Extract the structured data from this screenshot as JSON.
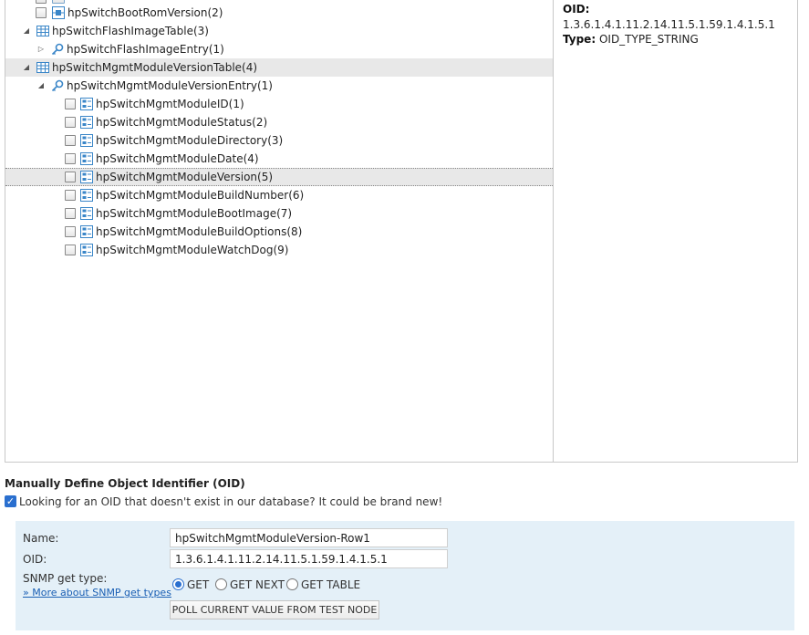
{
  "tree": {
    "nodes": [
      {
        "label": "hpSwitchBootRomVersion(2)",
        "type": "scalar",
        "checkbox": true,
        "expander": ""
      },
      {
        "label": "hpSwitchFlashImageTable(3)",
        "type": "table",
        "checkbox": false,
        "expander": "◢"
      },
      {
        "label": "hpSwitchFlashImageEntry(1)",
        "type": "entry",
        "checkbox": false,
        "expander": "▷"
      },
      {
        "label": "hpSwitchMgmtModuleVersionTable(4)",
        "type": "table",
        "checkbox": false,
        "expander": "◢",
        "highlighted": true
      },
      {
        "label": "hpSwitchMgmtModuleVersionEntry(1)",
        "type": "entry",
        "checkbox": false,
        "expander": "◢"
      },
      {
        "label": "hpSwitchMgmtModuleID(1)",
        "type": "column",
        "checkbox": true,
        "expander": ""
      },
      {
        "label": "hpSwitchMgmtModuleStatus(2)",
        "type": "column",
        "checkbox": true,
        "expander": ""
      },
      {
        "label": "hpSwitchMgmtModuleDirectory(3)",
        "type": "column",
        "checkbox": true,
        "expander": ""
      },
      {
        "label": "hpSwitchMgmtModuleDate(4)",
        "type": "column",
        "checkbox": true,
        "expander": ""
      },
      {
        "label": "hpSwitchMgmtModuleVersion(5)",
        "type": "column",
        "checkbox": true,
        "expander": "",
        "selected": true
      },
      {
        "label": "hpSwitchMgmtModuleBuildNumber(6)",
        "type": "column",
        "checkbox": true,
        "expander": ""
      },
      {
        "label": "hpSwitchMgmtModuleBootImage(7)",
        "type": "column",
        "checkbox": true,
        "expander": ""
      },
      {
        "label": "hpSwitchMgmtModuleBuildOptions(8)",
        "type": "column",
        "checkbox": true,
        "expander": ""
      },
      {
        "label": "hpSwitchMgmtModuleWatchDog(9)",
        "type": "column",
        "checkbox": true,
        "expander": ""
      }
    ]
  },
  "details": {
    "oid_label": "OID:",
    "oid_value": "1.3.6.1.4.1.11.2.14.11.5.1.59.1.4.1.5.1",
    "type_label": "Type:",
    "type_value": "OID_TYPE_STRING"
  },
  "manual": {
    "section_title": "Manually Define Object Identifier (OID)",
    "checkbox_label": "Looking for an OID that doesn't exist in our database? It could be brand new!",
    "checked": true,
    "name_label": "Name:",
    "name_value": "hpSwitchMgmtModuleVersion-Row1",
    "oid_label": "OID:",
    "oid_value": "1.3.6.1.4.1.11.2.14.11.5.1.59.1.4.1.5.1",
    "snmp_label": "SNMP get type:",
    "more_link": "» More about SNMP get types",
    "radio_options": [
      "GET",
      "GET NEXT",
      "GET TABLE"
    ],
    "radio_selected": "GET",
    "poll_button": "POLL CURRENT VALUE FROM TEST NODE"
  },
  "colors": {
    "form_bg": "#e4f0f8",
    "accent": "#2a6fcf",
    "link": "#1a5fb4",
    "icon_blue": "#3a86c8"
  }
}
